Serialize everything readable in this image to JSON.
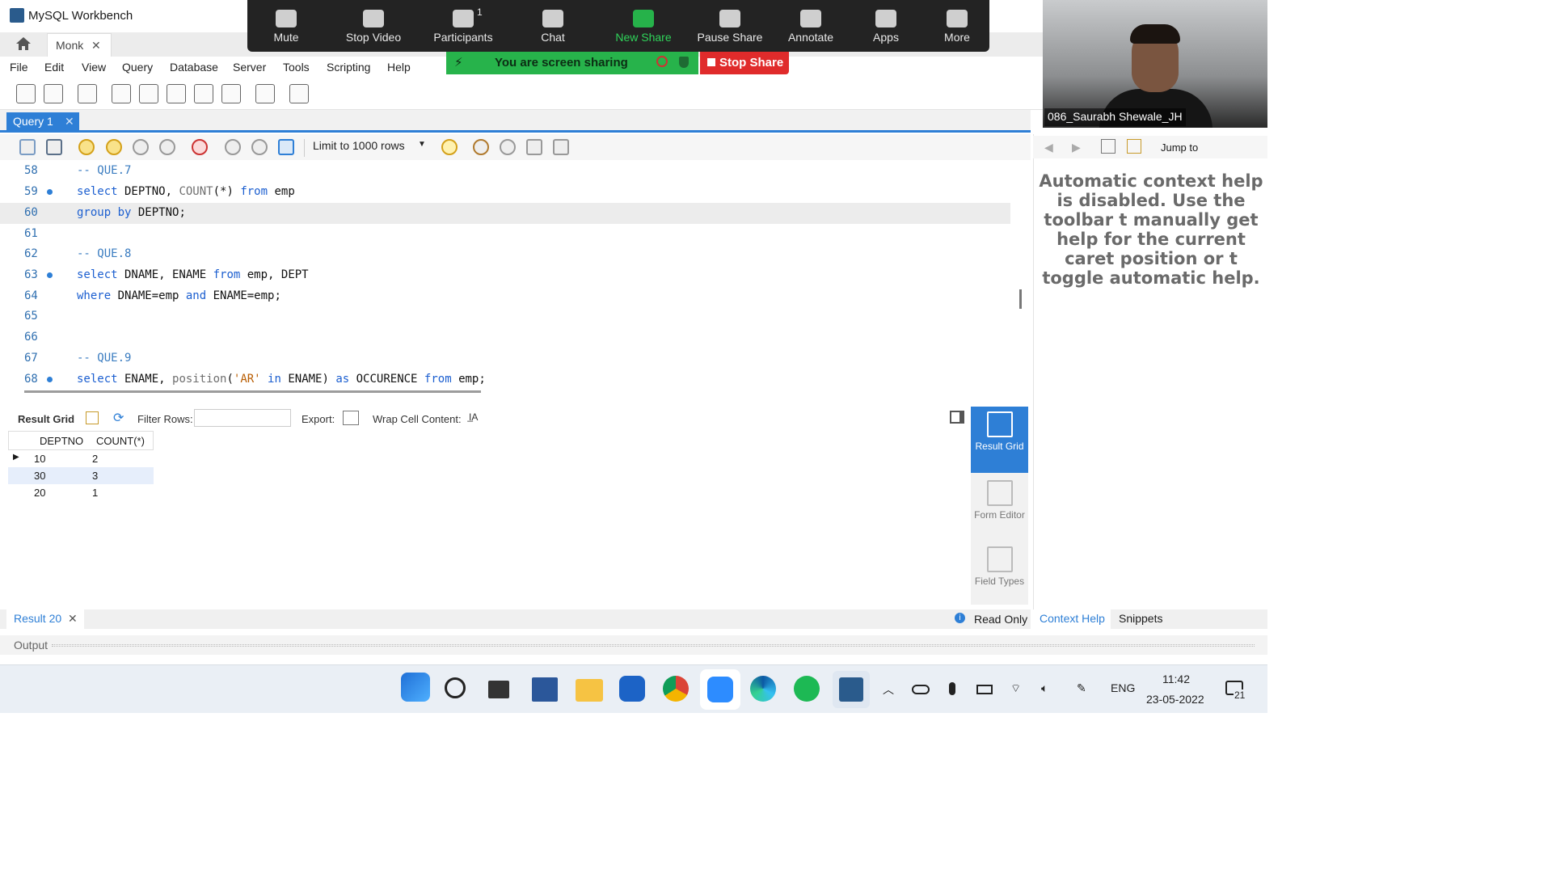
{
  "window": {
    "title": "MySQL Workbench",
    "connection_tab": "Monk"
  },
  "menu": [
    "File",
    "Edit",
    "View",
    "Query",
    "Database",
    "Server",
    "Tools",
    "Scripting",
    "Help"
  ],
  "zoom": {
    "buttons": [
      "Mute",
      "Stop Video",
      "Participants",
      "Chat",
      "New Share",
      "Pause Share",
      "Annotate",
      "Apps",
      "More"
    ],
    "participants_count": "1",
    "sharing_text": "You are screen sharing",
    "stop_share": "Stop Share"
  },
  "video": {
    "name": "086_Saurabh Shewale_JH"
  },
  "query_tab": "Query 1",
  "limit_select": "Limit to 1000 rows",
  "editor": {
    "lines": [
      {
        "n": "58",
        "dot": false,
        "text": "-- QUE.7"
      },
      {
        "n": "59",
        "dot": true,
        "text": "select DEPTNO, COUNT(*) from emp"
      },
      {
        "n": "60",
        "dot": false,
        "text": "group by DEPTNO;"
      },
      {
        "n": "61",
        "dot": false,
        "text": ""
      },
      {
        "n": "62",
        "dot": false,
        "text": "-- QUE.8"
      },
      {
        "n": "63",
        "dot": true,
        "text": "select DNAME, ENAME from emp, DEPT"
      },
      {
        "n": "64",
        "dot": false,
        "text": "where DNAME=emp and ENAME=emp;"
      },
      {
        "n": "65",
        "dot": false,
        "text": ""
      },
      {
        "n": "66",
        "dot": false,
        "text": ""
      },
      {
        "n": "67",
        "dot": false,
        "text": "-- QUE.9"
      },
      {
        "n": "68",
        "dot": true,
        "text": "select ENAME, position('AR' in ENAME) as OCCURENCE from emp;"
      }
    ]
  },
  "results": {
    "toolbar": {
      "result_grid": "Result Grid",
      "filter_rows": "Filter Rows:",
      "export": "Export:",
      "wrap": "Wrap Cell Content:"
    },
    "columns": [
      "DEPTNO",
      "COUNT(*)"
    ],
    "rows": [
      [
        "10",
        "2"
      ],
      [
        "30",
        "3"
      ],
      [
        "20",
        "1"
      ]
    ],
    "side_buttons": [
      "Result Grid",
      "Form Editor",
      "Field Types"
    ],
    "tab": "Result 20",
    "read_only": "Read Only"
  },
  "output_label": "Output",
  "right_panel": {
    "jump_to": "Jump to",
    "help_text": "Automatic context help is disabled. Use the toolbar t manually get help for the current caret position or t toggle automatic help.",
    "tabs": [
      "Context Help",
      "Snippets"
    ]
  },
  "taskbar": {
    "lang": "ENG",
    "time": "11:42",
    "date": "23-05-2022",
    "notifications": "21"
  }
}
